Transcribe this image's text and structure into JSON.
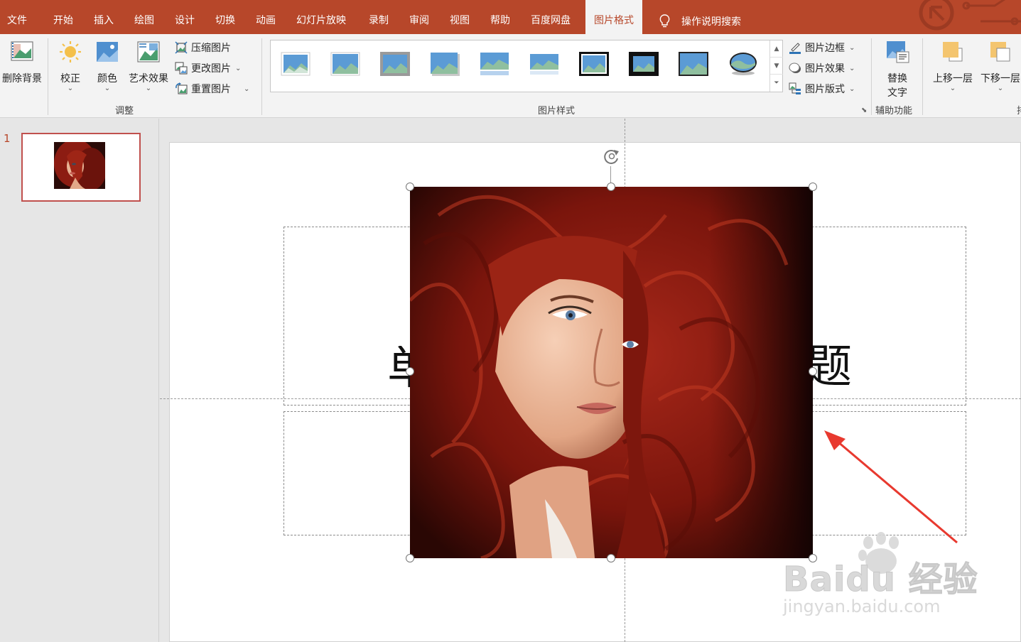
{
  "tabs": [
    "文件",
    "开始",
    "插入",
    "绘图",
    "设计",
    "切换",
    "动画",
    "幻灯片放映",
    "录制",
    "审阅",
    "视图",
    "帮助",
    "百度网盘",
    "图片格式"
  ],
  "active_tab": "图片格式",
  "tell_me": "操作说明搜索",
  "ribbon": {
    "adjust": {
      "remove_bg": "删除背景",
      "corrections": "校正",
      "color": "颜色",
      "artistic": "艺术效果",
      "compress": "压缩图片",
      "change": "更改图片",
      "reset": "重置图片",
      "group_label": "调整"
    },
    "styles": {
      "group_label": "图片样式",
      "border": "图片边框",
      "effects": "图片效果",
      "layout": "图片版式"
    },
    "accessibility": {
      "alt_text_line1": "替换",
      "alt_text_line2": "文字",
      "group_label": "辅助功能"
    },
    "arrange": {
      "bring_forward": "上移一层",
      "send_backward": "下移一层",
      "cut_label": "排"
    }
  },
  "thumbnail": {
    "number": "1"
  },
  "slide": {
    "title_left": "单",
    "title_right": "题"
  },
  "watermark": {
    "line1": "Baidu 经验",
    "line2": "jingyan.baidu.com"
  },
  "colors": {
    "accent": "#b7472a",
    "arrow": "#e8392f"
  }
}
